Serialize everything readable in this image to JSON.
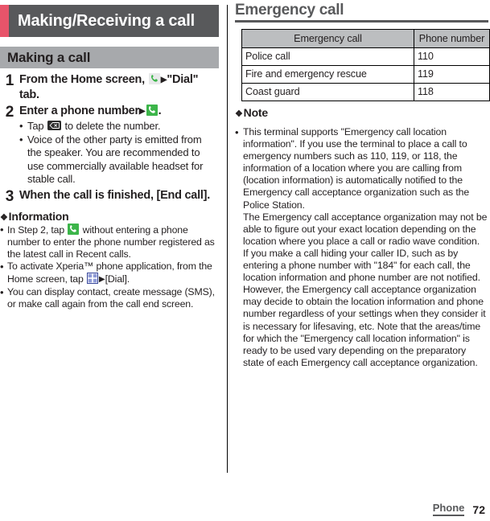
{
  "chapter": {
    "title": "Making/Receiving a call",
    "accent_color": "#e8546a",
    "bar_color": "#58595b"
  },
  "left": {
    "section": {
      "title": "Making a call",
      "bar_color": "#a7a9ac"
    },
    "steps": [
      {
        "num": "1",
        "head_pre": "From the Home screen, ",
        "head_post": "\"Dial\" tab.",
        "bullets": []
      },
      {
        "num": "2",
        "head_pre": "Enter a phone number",
        "head_post": ".",
        "bullets": [
          {
            "pre": "Tap ",
            "post": " to delete the number."
          },
          {
            "pre": "Voice of the other party is emitted from the speaker. You are recommended to use commercially available headset for stable call.",
            "post": ""
          }
        ]
      },
      {
        "num": "3",
        "head_pre": "When the call is finished, [End call].",
        "head_post": "",
        "bullets": []
      }
    ],
    "info": {
      "heading": "Information",
      "diamond": "❖",
      "items": [
        {
          "pre": "In Step 2, tap ",
          "post": " without entering a phone number to enter the phone number registered as the latest call in Recent calls."
        },
        {
          "pre": "To activate Xperia™ phone application, from the Home screen, tap ",
          "post": "[Dial]."
        },
        {
          "pre": "You can display contact, create message (SMS), or make call again from the call end screen.",
          "post": ""
        }
      ]
    }
  },
  "right": {
    "title": "Emergency call",
    "table": {
      "headers": [
        "Emergency call",
        "Phone number"
      ],
      "rows": [
        [
          "Police call",
          "110"
        ],
        [
          "Fire and emergency rescue",
          "119"
        ],
        [
          "Coast guard",
          "118"
        ]
      ]
    },
    "note": {
      "heading": "Note",
      "diamond": "❖",
      "paragraphs": [
        "This terminal supports \"Emergency call location information\". If you use the terminal to place a call to emergency numbers such as 110, 119, or 118, the information of a location where you are calling from (location information) is automatically notified to the Emergency call acceptance organization such as the Police Station.",
        "The Emergency call acceptance organization may not be able to figure out your exact location depending on the location where you place a call or radio wave condition.",
        "If you make a call hiding your caller ID, such as by entering a phone number with \"184\" for each call, the location information and phone number are not notified. However, the Emergency call acceptance organization may decide to obtain the location information and phone number regardless of your settings when they consider it is necessary for lifesaving, etc. Note that the areas/time for which the \"Emergency call location information\" is ready to be used vary depending on the preparatory state of each Emergency call acceptance organization."
      ]
    }
  },
  "footer": {
    "chapter_label": "Phone",
    "page_number": "72"
  },
  "glyphs": {
    "bullet_dot": "•",
    "triangle": "▶"
  },
  "icons": {
    "phone": "phone-handset-icon",
    "delete": "backspace-delete-icon",
    "grid": "app-grid-icon"
  }
}
